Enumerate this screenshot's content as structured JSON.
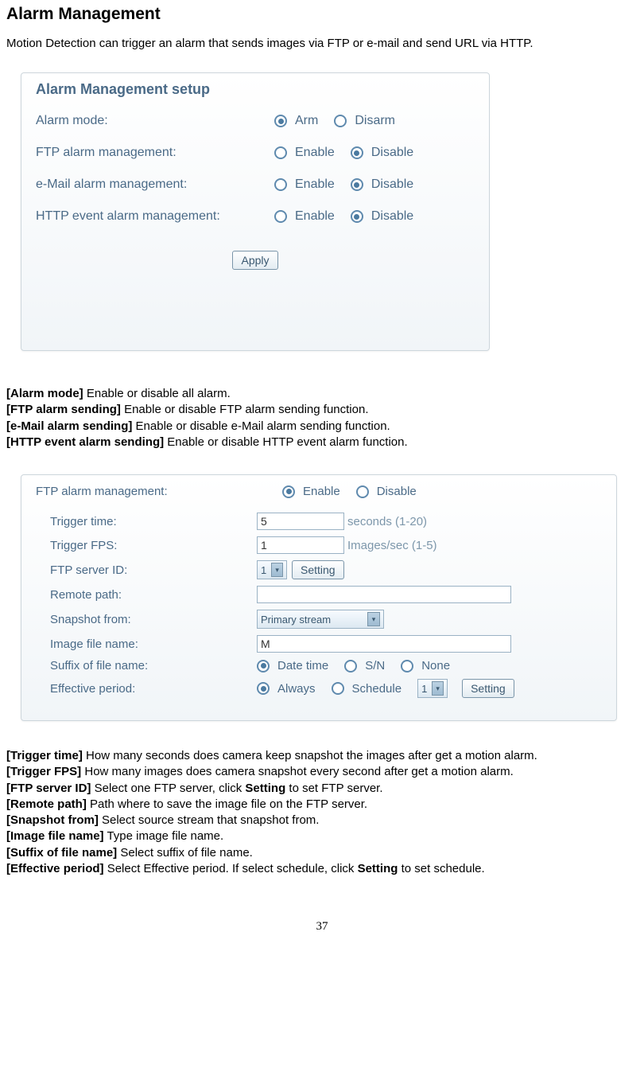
{
  "page": {
    "title": "Alarm Management",
    "intro": "Motion Detection can trigger an alarm that sends images via FTP or e-mail and send URL via HTTP.",
    "page_number": "37"
  },
  "panel1": {
    "title": "Alarm Management setup",
    "rows": [
      {
        "label": "Alarm mode:",
        "opt1": "Arm",
        "opt2": "Disarm",
        "checked": 1
      },
      {
        "label": "FTP alarm management:",
        "opt1": "Enable",
        "opt2": "Disable",
        "checked": 2
      },
      {
        "label": "e-Mail alarm management:",
        "opt1": "Enable",
        "opt2": "Disable",
        "checked": 2
      },
      {
        "label": "HTTP event alarm management:",
        "opt1": "Enable",
        "opt2": "Disable",
        "checked": 2
      }
    ],
    "apply": "Apply"
  },
  "defs1": [
    {
      "term": "[Alarm mode]",
      "desc": " Enable or disable all alarm."
    },
    {
      "term": "[FTP alarm sending]",
      "desc": " Enable or disable FTP alarm sending function."
    },
    {
      "term": "[e-Mail alarm sending]",
      "desc": " Enable or disable e-Mail alarm sending function."
    },
    {
      "term": "[HTTP event alarm sending]",
      "desc": " Enable or disable HTTP event alarm function."
    }
  ],
  "panel2": {
    "top": {
      "label": "FTP alarm management:",
      "opt1": "Enable",
      "opt2": "Disable",
      "checked": 1
    },
    "trigger_time": {
      "label": "Trigger time:",
      "value": "5",
      "hint": "seconds (1-20)"
    },
    "trigger_fps": {
      "label": "Trigger FPS:",
      "value": "1",
      "hint": "Images/sec (1-5)"
    },
    "ftp_server": {
      "label": "FTP server ID:",
      "value": "1",
      "button": "Setting"
    },
    "remote_path": {
      "label": "Remote path:",
      "value": ""
    },
    "snapshot_from": {
      "label": "Snapshot from:",
      "value": "Primary stream"
    },
    "image_file_name": {
      "label": "Image file name:",
      "value": "M"
    },
    "suffix": {
      "label": "Suffix of file name:",
      "opt1": "Date time",
      "opt2": "S/N",
      "opt3": "None",
      "checked": 1
    },
    "effective": {
      "label": "Effective period:",
      "opt1": "Always",
      "opt2": "Schedule",
      "checked": 1,
      "select": "1",
      "button": "Setting"
    }
  },
  "defs2": [
    {
      "term": "[Trigger time]",
      "desc": " How many seconds does camera keep snapshot the images after get a motion alarm."
    },
    {
      "term": "[Trigger FPS]",
      "desc": " How many images does camera snapshot every second after get a motion alarm."
    },
    {
      "term": "[FTP server ID]",
      "desc_pre": " Select one FTP server, click ",
      "bold": "Setting",
      "desc_post": " to set FTP server."
    },
    {
      "term": "[Remote path]",
      "desc": " Path where to save the image file on the FTP server."
    },
    {
      "term": "[Snapshot from]",
      "desc": " Select source stream that snapshot from."
    },
    {
      "term": "[Image file name]",
      "desc": " Type image file name."
    },
    {
      "term": "[Suffix of file name]",
      "desc": " Select suffix of file name."
    },
    {
      "term": "[Effective period]",
      "desc_pre": " Select Effective period. If select schedule, click ",
      "bold": "Setting",
      "desc_post": " to set schedule."
    }
  ]
}
